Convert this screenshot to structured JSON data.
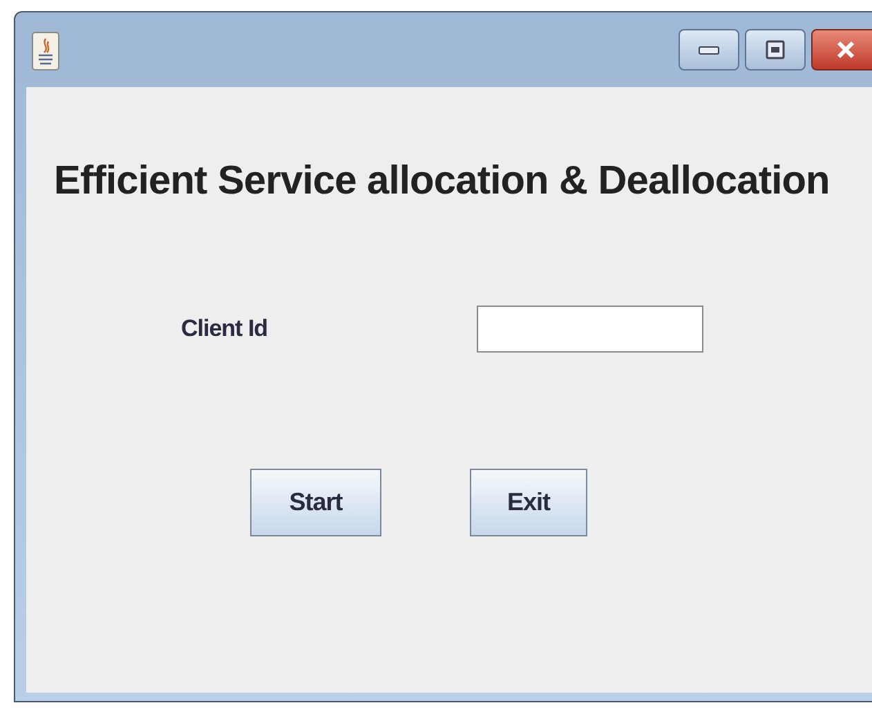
{
  "heading": "Efficient Service allocation & Deallocation",
  "form": {
    "label": "Client Id"
  },
  "buttons": [
    "Start",
    "Exit"
  ]
}
